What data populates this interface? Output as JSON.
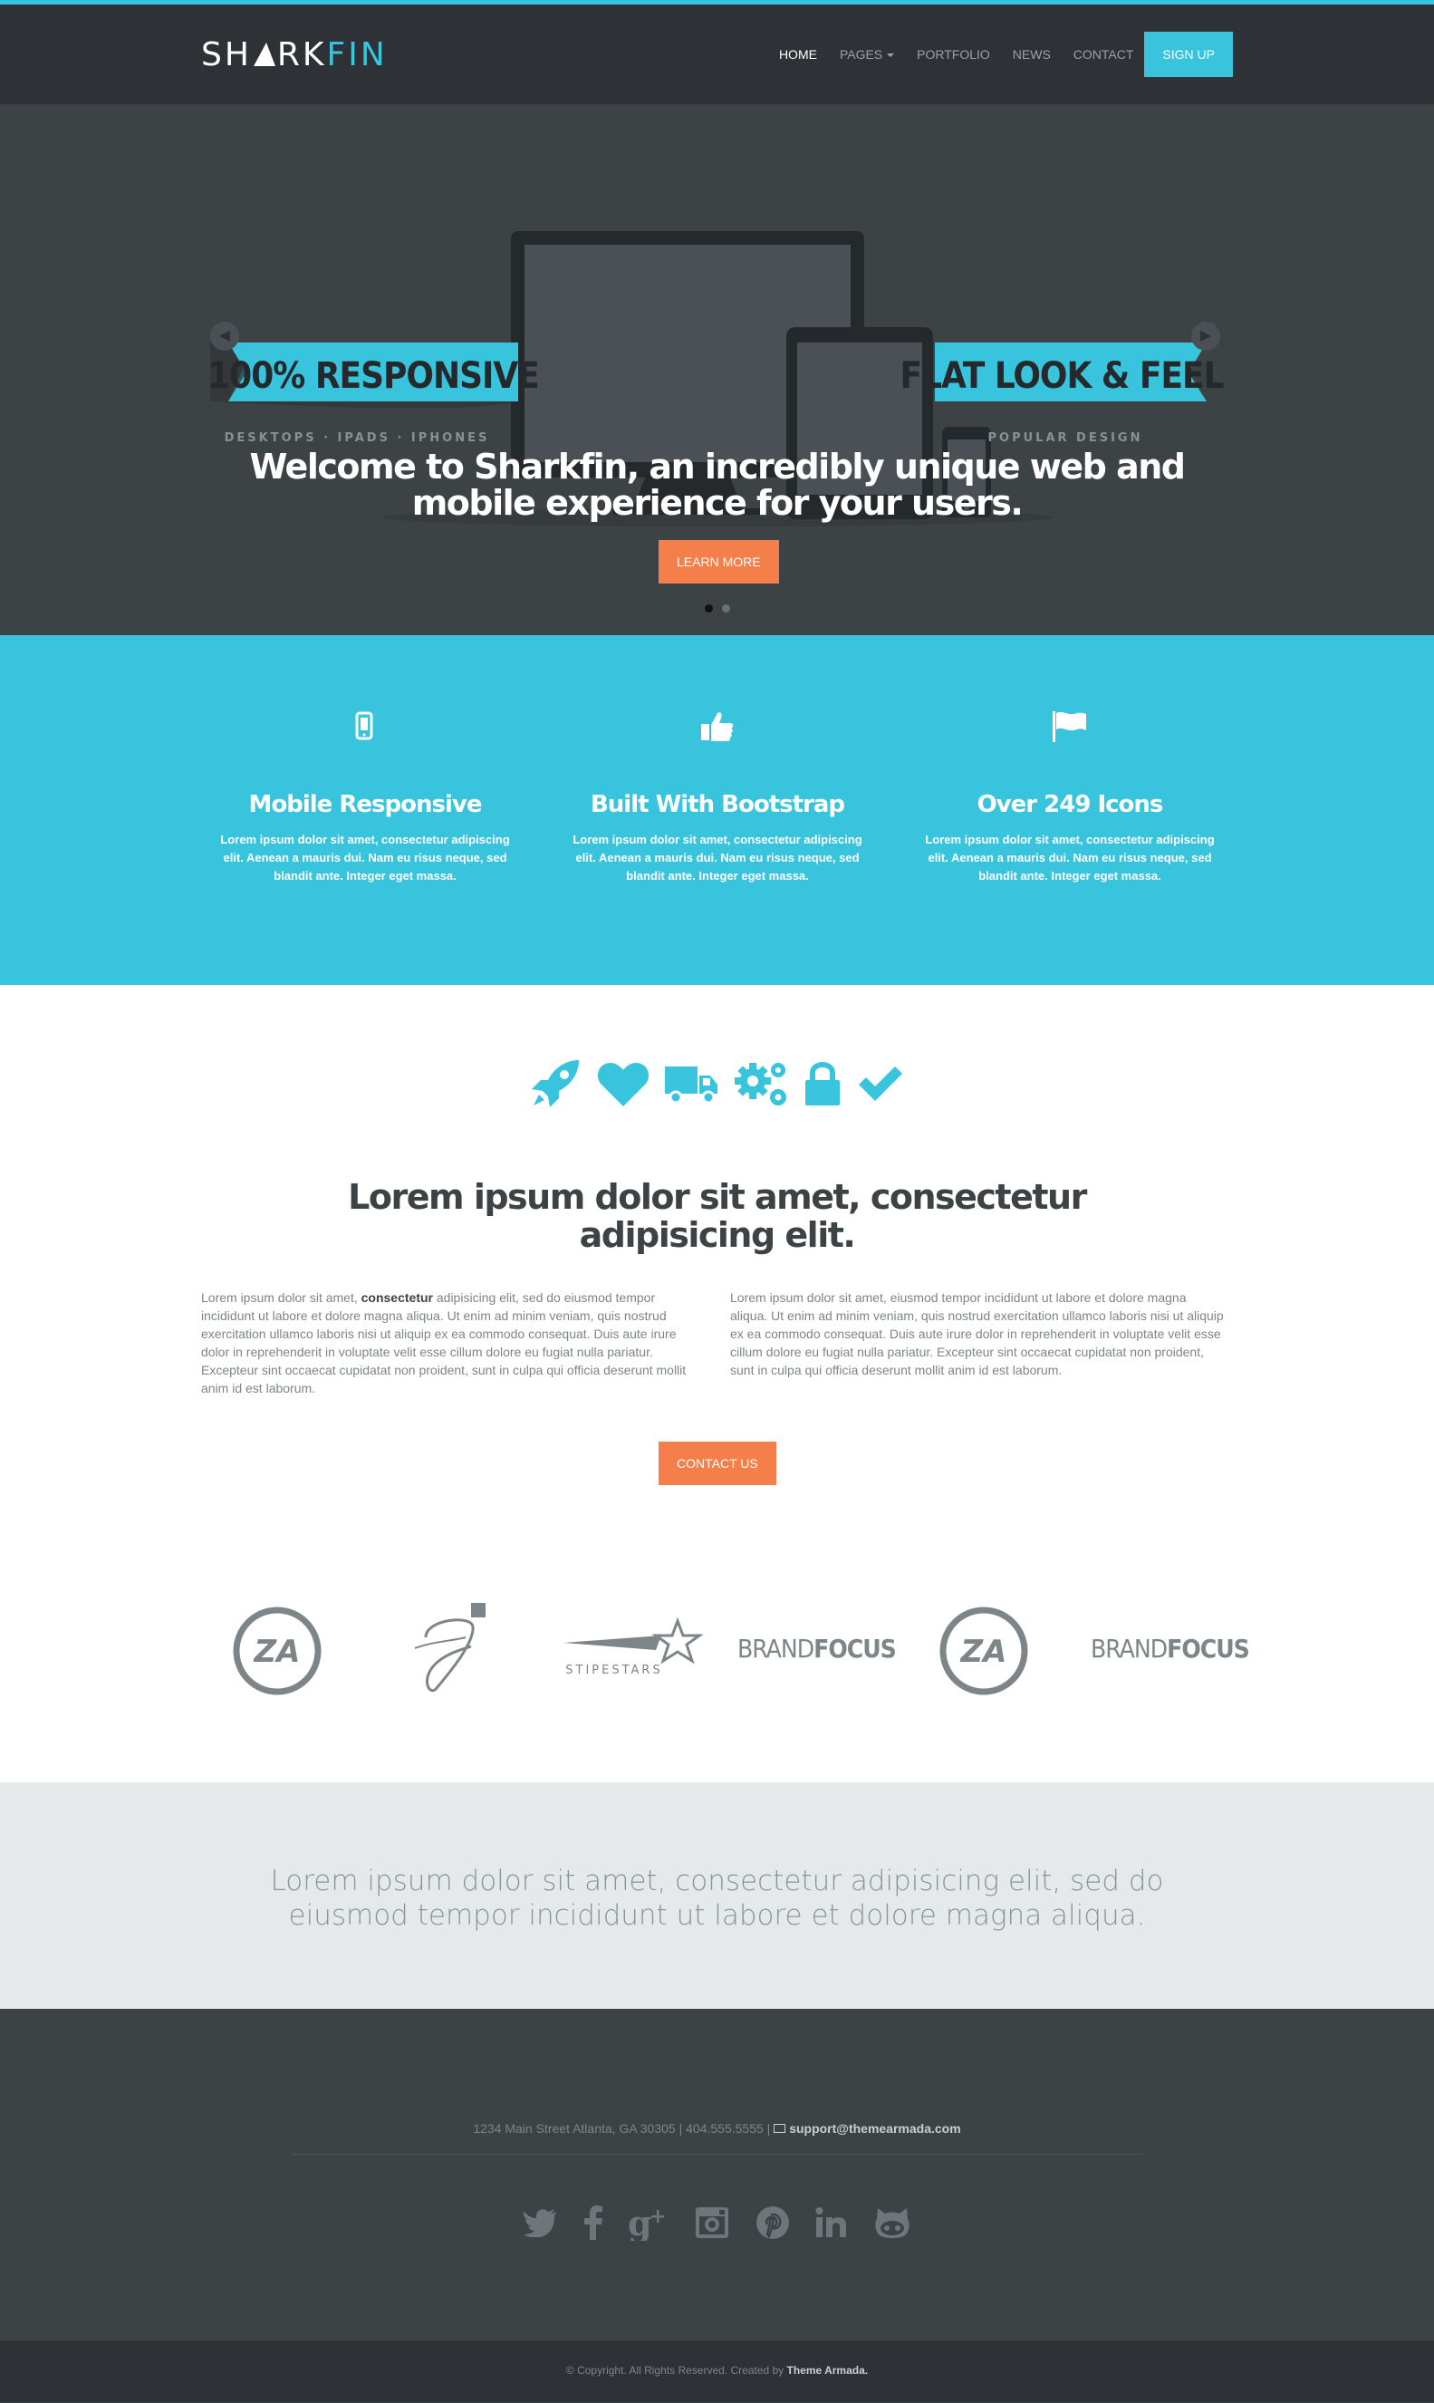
{
  "header": {
    "logo_part1": "SH",
    "logo_part2": "RK",
    "logo_part3": "FIN",
    "nav": [
      {
        "label": "HOME"
      },
      {
        "label": "PAGES"
      },
      {
        "label": "PORTFOLIO"
      },
      {
        "label": "NEWS"
      },
      {
        "label": "CONTACT"
      }
    ],
    "signup_label": "SIGN UP",
    "accent_color": "#38c4dd"
  },
  "hero": {
    "banner_left": "100% RESPONSIVE",
    "banner_left_sub": "DESKTOPS · IPADS · IPHONES",
    "banner_right": "FLAT LOOK & FEEL",
    "banner_right_sub": "POPULAR DESIGN",
    "headline_line1": "Welcome to Sharkfin, an incredibly unique web and",
    "headline_line2": "mobile experience for your users.",
    "cta_label": "LEARN MORE",
    "slide_count": 2,
    "active_slide": 1
  },
  "features": [
    {
      "icon": "mobile-phone-icon",
      "title": "Mobile Responsive",
      "text": "Lorem ipsum dolor sit amet, consectetur adipiscing elit. Aenean a mauris dui. Nam eu risus neque, sed blandit ante. Integer eget massa."
    },
    {
      "icon": "thumbs-up-icon",
      "title": "Built With Bootstrap",
      "text": "Lorem ipsum dolor sit amet, consectetur adipiscing elit. Aenean a mauris dui. Nam eu risus neque, sed blandit ante. Integer eget massa."
    },
    {
      "icon": "flag-icon",
      "title": "Over 249 Icons",
      "text": "Lorem ipsum dolor sit amet, consectetur adipiscing elit. Aenean a mauris dui. Nam eu risus neque, sed blandit ante. Integer eget massa."
    }
  ],
  "intro": {
    "icons": [
      "rocket-icon",
      "heart-icon",
      "truck-icon",
      "gears-icon",
      "lock-icon",
      "checkmark-icon"
    ],
    "heading_line1": "Lorem ipsum dolor sit amet, consectetur",
    "heading_line2": "adipisicing elit.",
    "col_left_pre": "Lorem ipsum dolor sit amet, ",
    "col_left_bold": "consectetur",
    "col_left_post": " adipisicing elit, sed do eiusmod tempor incididunt ut labore et dolore magna aliqua. Ut enim ad minim veniam, quis nostrud exercitation ullamco laboris nisi ut aliquip ex ea commodo consequat. Duis aute irure dolor in reprehenderit in voluptate velit esse cillum dolore eu fugiat nulla pariatur. Excepteur sint occaecat cupidatat non proident, sunt in culpa qui officia deserunt mollit anim id est laborum.",
    "col_right": "Lorem ipsum dolor sit amet, eiusmod tempor incididunt ut labore et dolore magna aliqua. Ut enim ad minim veniam, quis nostrud exercitation ullamco laboris nisi ut aliquip ex ea commodo consequat. Duis aute irure dolor in reprehenderit in voluptate velit esse cillum dolore eu fugiat nulla pariatur. Excepteur sint occaecat cupidatat non proident, sunt in culpa qui officia deserunt mollit anim id est laborum.",
    "contact_label": "CONTACT US"
  },
  "brands": {
    "za": "ZA",
    "stipestars": "STIPESTARS",
    "brandfocus_a": "BRAND",
    "brandfocus_b": "FOCUS"
  },
  "quote": {
    "line1": "Lorem ipsum dolor sit amet, consectetur adipisicing elit, sed do",
    "line2": "eiusmod tempor incididunt ut labore et dolore magna aliqua."
  },
  "footer": {
    "address": "1234 Main Street Atlanta, GA 30305 | 404.555.5555 |",
    "email": "support@themearmada.com",
    "social": [
      "twitter-icon",
      "facebook-icon",
      "google-plus-icon",
      "instagram-icon",
      "pinterest-icon",
      "linkedin-icon",
      "github-icon"
    ],
    "copyright_pre": "© Copyright. All Rights Reserved. Created by",
    "copyright_link": "Theme Armada."
  }
}
